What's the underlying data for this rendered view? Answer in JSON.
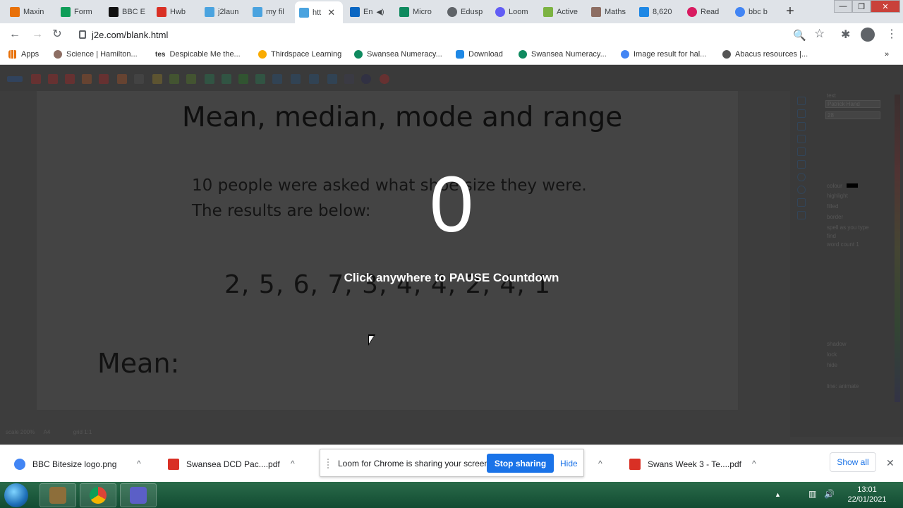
{
  "browser": {
    "tabs": [
      {
        "label": "Maxin",
        "color": "#e8710a"
      },
      {
        "label": "Form",
        "color": "#0f9d58"
      },
      {
        "label": "BBC E",
        "color": "#111111"
      },
      {
        "label": "Hwb",
        "color": "#d93025"
      },
      {
        "label": "j2laun",
        "color": "#4aa3df"
      },
      {
        "label": "my fil",
        "color": "#4aa3df"
      },
      {
        "label": "htt",
        "color": "#4aa3df"
      },
      {
        "label": "En",
        "color": "#0a66c2"
      },
      {
        "label": "Micro",
        "color": "#0f8a5f"
      },
      {
        "label": "Edusp",
        "color": "#5f6368"
      },
      {
        "label": "Loom",
        "color": "#625df5"
      },
      {
        "label": "Active",
        "color": "#7cb342"
      },
      {
        "label": "Maths",
        "color": "#8d6e63"
      },
      {
        "label": "8,620",
        "color": "#1e88e5"
      },
      {
        "label": "Read",
        "color": "#d81b60"
      },
      {
        "label": "bbc b",
        "color": "#4285f4"
      }
    ],
    "new_tab": "+",
    "window_controls": {
      "minimize": "—",
      "maximize": "❐",
      "close": "✕"
    },
    "url": "j2e.com/blank.html",
    "nav": {
      "back": "←",
      "forward": "→",
      "reload": "↻"
    },
    "toolbar_icons": {
      "zoom": "🔍",
      "star": "☆",
      "extensions": "✱",
      "menu": "⋮"
    }
  },
  "bookmarks": [
    {
      "label": "Apps",
      "color": "#e8710a"
    },
    {
      "label": "Science | Hamilton...",
      "color": "#8d6e63"
    },
    {
      "label": "Despicable Me the...",
      "color": "#222222"
    },
    {
      "label": "Thirdspace Learning",
      "color": "#f9ab00"
    },
    {
      "label": "Swansea Numeracy...",
      "color": "#0f8a5f"
    },
    {
      "label": "Download",
      "color": "#1e88e5"
    },
    {
      "label": "Swansea Numeracy...",
      "color": "#0f8a5f"
    },
    {
      "label": "Image result for hal...",
      "color": "#4285f4"
    },
    {
      "label": "Abacus resources |...",
      "color": "#555555"
    }
  ],
  "bookmarks_more": "»",
  "tes_label": "tes",
  "document": {
    "title": "Mean, median, mode and range",
    "line1": "10 people were asked what shoe size they were.",
    "line2": "The results are below:",
    "numbers": "2, 5, 6, 7, 3, 4, 4, 2, 4, 1",
    "mean_label": "Mean:"
  },
  "side_panel": {
    "heading": "text",
    "font": "Patrick Hand",
    "size": "28",
    "colour": "colour",
    "options": [
      "highlight",
      "filled",
      "border",
      "spell as you type",
      "find",
      "word count 1"
    ],
    "bottom_options": [
      "shadow",
      "lock",
      "hide"
    ],
    "line_label": "line: animate"
  },
  "status": {
    "scale": "scale 200%",
    "paper": "A4",
    "grid": "grid 1:1"
  },
  "overlay": {
    "countdown": "0",
    "message": "Click anywhere to PAUSE Countdown"
  },
  "downloads": {
    "items": [
      {
        "label": "BBC Bitesize logo.png",
        "color": "#4285f4"
      },
      {
        "label": "Swansea DCD Pac....pdf",
        "color": "#d93025"
      },
      {
        "label": "Swans Week 3 - Te....pdf",
        "color": "#d93025"
      }
    ],
    "chevron": "^",
    "loom": {
      "message": "Loom for Chrome is sharing your screen.",
      "stop": "Stop sharing",
      "hide": "Hide"
    },
    "show_all": "Show all",
    "close": "✕"
  },
  "taskbar": {
    "apps": [
      {
        "name": "minecraft",
        "color": "#8d6e3a"
      },
      {
        "name": "chrome",
        "color": "#db4437"
      },
      {
        "name": "teams",
        "color": "#5b5fc7"
      }
    ],
    "time": "13:01",
    "date": "22/01/2021",
    "tray": {
      "arrow": "▲",
      "network": "▥",
      "volume": "🔊"
    }
  }
}
